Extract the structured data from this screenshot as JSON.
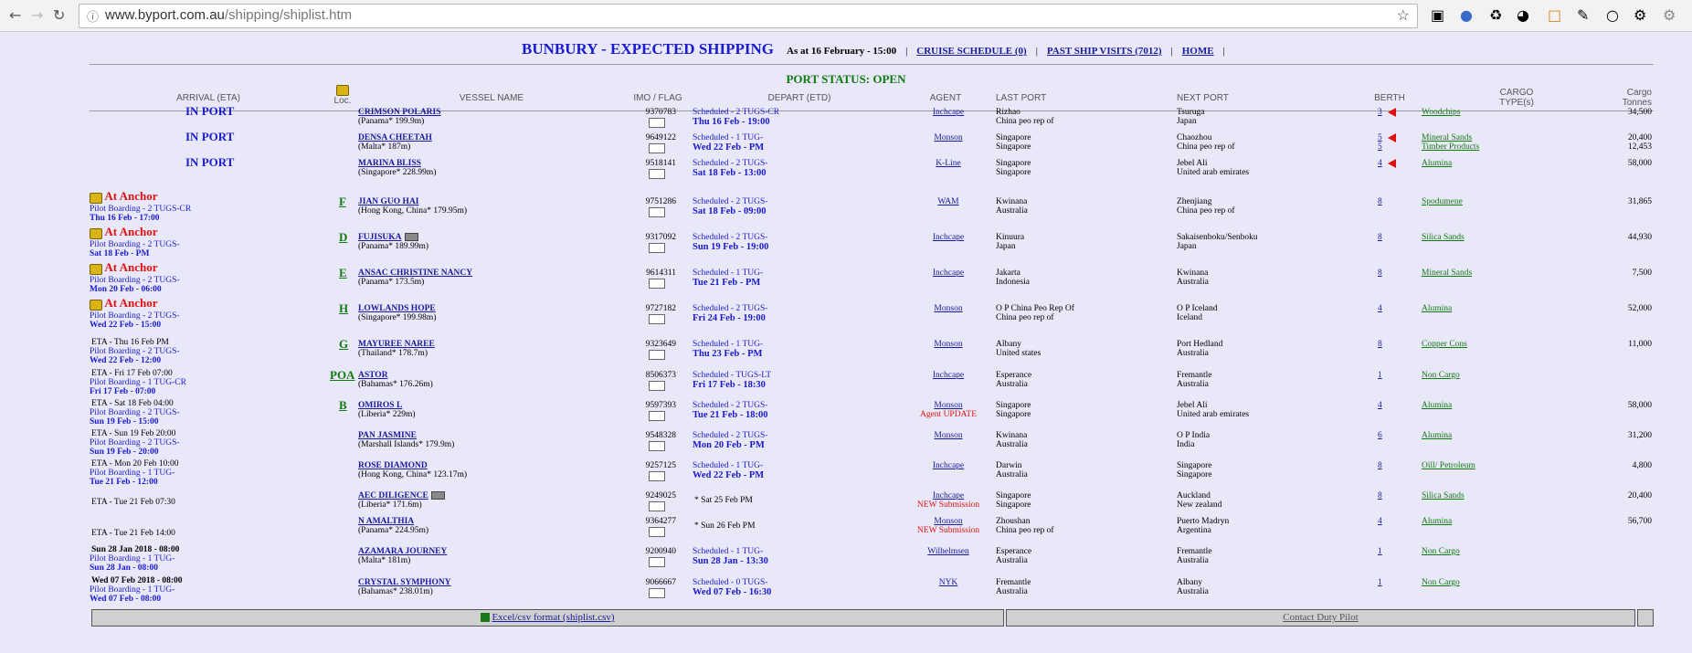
{
  "browser": {
    "url_host": "www.byport.com.au",
    "url_path": "/shipping/shiplist.htm"
  },
  "header": {
    "title": "BUNBURY - EXPECTED SHIPPING",
    "as_at": "As at 16 February - 15:00",
    "links": [
      "CRUISE SCHEDULE (0)",
      "PAST SHIP VISITS (7012)",
      "HOME"
    ]
  },
  "port_status": "PORT STATUS: OPEN",
  "columns": {
    "arrival": "ARRIVAL (ETA)",
    "loc": "Loc.",
    "vessel": "VESSEL NAME",
    "imo": "IMO / FLAG",
    "depart": "DEPART (ETD)",
    "agent": "AGENT",
    "last_port": "LAST PORT",
    "next_port": "NEXT PORT",
    "berth": "BERTH",
    "cargo_type_1": "CARGO",
    "cargo_type_2": "TYPE(s)",
    "cargo_t_1": "Cargo",
    "cargo_t_2": "Tonnes"
  },
  "rows": [
    {
      "arr1": "IN PORT",
      "arr2": "",
      "arr3": "",
      "loc": "",
      "name": "CRIMSON POLARIS",
      "flag": "(Panama* 199.9m)",
      "imo": "9370783",
      "dep1": "Scheduled - 2 TUGS-CR",
      "dep2": "Thu 16 Feb - 19:00",
      "agent": "Inchcape",
      "agent2": "",
      "lp1": "Rizhao",
      "lp2": "China peo rep of",
      "np1": "Tsuruga",
      "np2": "Japan",
      "berth": "3",
      "berth2": "",
      "cargo": "Woodchips",
      "cargo2": "",
      "t1": "34,500",
      "t2": ""
    },
    {
      "arr1": "IN PORT",
      "arr2": "",
      "arr3": "",
      "loc": "",
      "name": "DENSA CHEETAH",
      "flag": "(Malta* 187m)",
      "imo": "9649122",
      "dep1": "Scheduled - 1 TUG-",
      "dep2": "Wed 22 Feb - PM",
      "agent": "Monson",
      "agent2": "",
      "lp1": "Singapore",
      "lp2": "Singapore",
      "np1": "Chaozhou",
      "np2": "China peo rep of",
      "berth": "5",
      "berth2": "5",
      "cargo": "Mineral Sands",
      "cargo2": "Timber Products",
      "t1": "20,400",
      "t2": "12,453"
    },
    {
      "arr1": "IN PORT",
      "arr2": "",
      "arr3": "",
      "loc": "",
      "name": "MARINA BLISS",
      "flag": "(Singapore* 228.99m)",
      "imo": "9518141",
      "dep1": "Scheduled - 2 TUGS-",
      "dep2": "Sat 18 Feb - 13:00",
      "agent": "K-Line",
      "agent2": "",
      "lp1": "Singapore",
      "lp2": "Singapore",
      "np1": "Jebel Ali",
      "np2": "United arab emirates",
      "berth": "4",
      "berth2": "",
      "cargo": "Alumina",
      "cargo2": "",
      "t1": "58,000",
      "t2": ""
    },
    {
      "arr1": "At Anchor",
      "arr2": "Pilot Boarding - 2 TUGS-CR",
      "arr3": "Thu 16 Feb - 17:00",
      "loc": "F",
      "name": "JIAN GUO HAI",
      "flag": "(Hong Kong, China* 179.95m)",
      "imo": "9751286",
      "dep1": "Scheduled - 2 TUGS-",
      "dep2": "Sat 18 Feb - 09:00",
      "agent": "WAM",
      "agent2": "",
      "lp1": "Kwinana",
      "lp2": "Australia",
      "np1": "Zhenjiang",
      "np2": "China peo rep of",
      "berth": "8",
      "berth2": "",
      "cargo": "Spodumene",
      "cargo2": "",
      "t1": "31,865",
      "t2": ""
    },
    {
      "arr1": "At Anchor",
      "arr2": "Pilot Boarding - 2 TUGS-",
      "arr3": "Sat 18 Feb - PM",
      "loc": "D",
      "name": "FUJISUKA",
      "flag": "(Panama* 189.99m)",
      "imo": "9317092",
      "dep1": "Scheduled - 2 TUGS-",
      "dep2": "Sun 19 Feb - 19:00",
      "agent": "Inchcape",
      "agent2": "",
      "lp1": "Kinuura",
      "lp2": "Japan",
      "np1": "Sakaisenboku/Senboku",
      "np2": "Japan",
      "berth": "8",
      "berth2": "",
      "cargo": "Silica Sands",
      "cargo2": "",
      "t1": "44,930",
      "t2": ""
    },
    {
      "arr1": "At Anchor",
      "arr2": "Pilot Boarding - 2 TUGS-",
      "arr3": "Mon 20 Feb - 06:00",
      "loc": "E",
      "name": "ANSAC CHRISTINE NANCY",
      "flag": "(Panama* 173.5m)",
      "imo": "9614311",
      "dep1": "Scheduled - 1 TUG-",
      "dep2": "Tue 21 Feb - PM",
      "agent": "Inchcape",
      "agent2": "",
      "lp1": "Jakarta",
      "lp2": "Indonesia",
      "np1": "Kwinana",
      "np2": "Australia",
      "berth": "8",
      "berth2": "",
      "cargo": "Mineral Sands",
      "cargo2": "",
      "t1": "7,500",
      "t2": ""
    },
    {
      "arr1": "At Anchor",
      "arr2": "Pilot Boarding - 2 TUGS-",
      "arr3": "Wed 22 Feb - 15:00",
      "loc": "H",
      "name": "LOWLANDS HOPE",
      "flag": "(Singapore* 199.98m)",
      "imo": "9727182",
      "dep1": "Scheduled - 2 TUGS-",
      "dep2": "Fri 24 Feb - 19:00",
      "agent": "Monson",
      "agent2": "",
      "lp1": "O P China Peo Rep Of",
      "lp2": "China peo rep of",
      "np1": "O P Iceland",
      "np2": "Iceland",
      "berth": "4",
      "berth2": "",
      "cargo": "Alumina",
      "cargo2": "",
      "t1": "52,000",
      "t2": ""
    },
    {
      "arr1": "ETA - Thu 16 Feb PM",
      "arr2": "Pilot Boarding - 2 TUGS-",
      "arr3": "Wed 22 Feb - 12:00",
      "loc": "G",
      "name": "MAYUREE NAREE",
      "flag": "(Thailand* 178.7m)",
      "imo": "9323649",
      "dep1": "Scheduled - 1 TUG-",
      "dep2": "Thu 23 Feb - PM",
      "agent": "Monson",
      "agent2": "",
      "lp1": "Albany",
      "lp2": "United states",
      "np1": "Port Hedland",
      "np2": "Australia",
      "berth": "8",
      "berth2": "",
      "cargo": "Copper Cons",
      "cargo2": "",
      "t1": "11,000",
      "t2": ""
    },
    {
      "arr1": "ETA - Fri 17 Feb 07:00",
      "arr2": "Pilot Boarding - 1 TUG-CR",
      "arr3": "Fri 17 Feb - 07:00",
      "loc": "POA",
      "name": "ASTOR",
      "flag": "(Bahamas* 176.26m)",
      "imo": "8506373",
      "dep1": "Scheduled - TUGS-LT",
      "dep2": "Fri 17 Feb - 18:30",
      "agent": "Inchcape",
      "agent2": "",
      "lp1": "Esperance",
      "lp2": "Australia",
      "np1": "Fremantle",
      "np2": "Australia",
      "berth": "1",
      "berth2": "",
      "cargo": "Non Cargo",
      "cargo2": "",
      "t1": "",
      "t2": ""
    },
    {
      "arr1": "ETA - Sat 18 Feb 04:00",
      "arr2": "Pilot Boarding - 2 TUGS-",
      "arr3": "Sun 19 Feb - 15:00",
      "loc": "B",
      "name": "OMIROS L",
      "flag": "(Liberia* 229m)",
      "imo": "9597393",
      "dep1": "Scheduled - 2 TUGS-",
      "dep2": "Tue 21 Feb - 18:00",
      "agent": "Monson",
      "agent2": "Agent UPDATE",
      "lp1": "Singapore",
      "lp2": "Singapore",
      "np1": "Jebel Ali",
      "np2": "United arab emirates",
      "berth": "4",
      "berth2": "",
      "cargo": "Alumina",
      "cargo2": "",
      "t1": "58,000",
      "t2": ""
    },
    {
      "arr1": "ETA - Sun 19 Feb 20:00",
      "arr2": "Pilot Boarding - 2 TUGS-",
      "arr3": "Sun 19 Feb - 20:00",
      "loc": "",
      "name": "PAN JASMINE",
      "flag": "(Marshall Islands* 179.9m)",
      "imo": "9548328",
      "dep1": "Scheduled - 2 TUGS-",
      "dep2": "Mon 20 Feb - PM",
      "agent": "Monson",
      "agent2": "",
      "lp1": "Kwinana",
      "lp2": "Australia",
      "np1": "O P India",
      "np2": "India",
      "berth": "6",
      "berth2": "",
      "cargo": "Alumina",
      "cargo2": "",
      "t1": "31,200",
      "t2": ""
    },
    {
      "arr1": "ETA - Mon 20 Feb 10:00",
      "arr2": "Pilot Boarding - 1 TUG-",
      "arr3": "Tue 21 Feb - 12:00",
      "loc": "",
      "name": "ROSE DIAMOND",
      "flag": "(Hong Kong, China* 123.17m)",
      "imo": "9257125",
      "dep1": "Scheduled - 1 TUG-",
      "dep2": "Wed 22 Feb - PM",
      "agent": "Inchcape",
      "agent2": "",
      "lp1": "Darwin",
      "lp2": "Australia",
      "np1": "Singapore",
      "np2": "Singapore",
      "berth": "8",
      "berth2": "",
      "cargo": "Oill/ Petroleum",
      "cargo2": "",
      "t1": "4,800",
      "t2": ""
    },
    {
      "arr1": "ETA - Tue 21 Feb 07:30",
      "arr2": "",
      "arr3": "",
      "loc": "",
      "name": "AEC DILIGENCE",
      "flag": "(Liberia* 171.6m)",
      "imo": "9249025",
      "dep1": "* Sat 25 Feb PM",
      "dep2": "",
      "agent": "Inchcape",
      "agent2": "NEW Submission",
      "lp1": "Singapore",
      "lp2": "Singapore",
      "np1": "Auckland",
      "np2": "New zealand",
      "berth": "8",
      "berth2": "",
      "cargo": "Silica Sands",
      "cargo2": "",
      "t1": "20,400",
      "t2": ""
    },
    {
      "arr1": "ETA - Tue 21 Feb 14:00",
      "arr2": "",
      "arr3": "",
      "loc": "",
      "name": "N AMALTHIA",
      "flag": "(Panama* 224.95m)",
      "imo": "9364277",
      "dep1": "* Sun 26 Feb PM",
      "dep2": "",
      "agent": "Monson",
      "agent2": "NEW Submission",
      "lp1": "Zhoushan",
      "lp2": "China peo rep of",
      "np1": "Puerto Madryn",
      "np2": "Argentina",
      "berth": "4",
      "berth2": "",
      "cargo": "Alumina",
      "cargo2": "",
      "t1": "56,700",
      "t2": ""
    },
    {
      "arr1": "Sun 28 Jan 2018 - 08:00",
      "arr2": "Pilot Boarding - 1 TUG-",
      "arr3": "Sun 28 Jan - 08:00",
      "loc": "",
      "name": "AZAMARA JOURNEY",
      "flag": "(Malta* 181m)",
      "imo": "9200940",
      "dep1": "Scheduled - 1 TUG-",
      "dep2": "Sun 28 Jan - 13:30",
      "agent": "Wilhelmsen",
      "agent2": "",
      "lp1": "Esperance",
      "lp2": "Australia",
      "np1": "Fremantle",
      "np2": "Australia",
      "berth": "1",
      "berth2": "",
      "cargo": "Non Cargo",
      "cargo2": "",
      "t1": "",
      "t2": ""
    },
    {
      "arr1": "Wed 07 Feb 2018 - 08:00",
      "arr2": "Pilot Boarding - 1 TUG-",
      "arr3": "Wed 07 Feb - 08:00",
      "loc": "",
      "name": "CRYSTAL SYMPHONY",
      "flag": "(Bahamas* 238.01m)",
      "imo": "9066667",
      "dep1": "Scheduled - 0 TUGS-",
      "dep2": "Wed 07 Feb - 16:30",
      "agent": "NYK",
      "agent2": "",
      "lp1": "Fremantle",
      "lp2": "Australia",
      "np1": "Albany",
      "np2": "Australia",
      "berth": "1",
      "berth2": "",
      "cargo": "Non Cargo",
      "cargo2": "",
      "t1": "",
      "t2": ""
    }
  ],
  "footer": {
    "excel": "Excel/csv format (shiplist.csv)",
    "contact": "Contact Duty Pilot"
  }
}
